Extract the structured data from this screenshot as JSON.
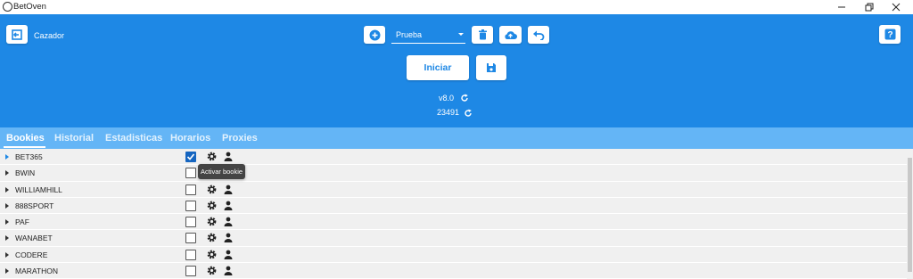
{
  "window": {
    "title": "BetOven",
    "minimize_icon": "minimize-icon",
    "maximize_icon": "restore-icon",
    "close_icon": "close-icon"
  },
  "header": {
    "mode_label": "Cazador",
    "profile": {
      "selected": "Prueba"
    },
    "start_label": "Iniciar",
    "version": "v8.0",
    "build": "23491",
    "accent_color": "#1e88e5"
  },
  "tabs": [
    {
      "label": "Bookies",
      "active": true
    },
    {
      "label": "Historial",
      "active": false
    },
    {
      "label": "Estadisticas",
      "active": false
    },
    {
      "label": "Horarios",
      "active": false
    },
    {
      "label": "Proxies",
      "active": false
    }
  ],
  "bookies": [
    {
      "name": "BET365",
      "enabled": true
    },
    {
      "name": "BWIN",
      "enabled": false
    },
    {
      "name": "WILLIAMHILL",
      "enabled": false
    },
    {
      "name": "888SPORT",
      "enabled": false
    },
    {
      "name": "PAF",
      "enabled": false
    },
    {
      "name": "WANABET",
      "enabled": false
    },
    {
      "name": "CODERE",
      "enabled": false
    },
    {
      "name": "MARATHON",
      "enabled": false
    }
  ],
  "tooltip": "Activar bookie"
}
